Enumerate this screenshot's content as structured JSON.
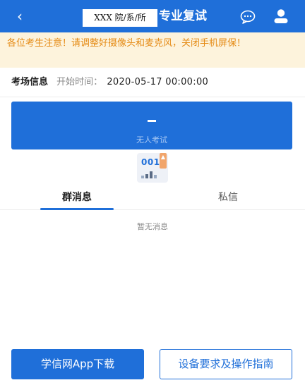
{
  "header": {
    "back_icon": "chevron-left-icon",
    "title_mask": "XXX 院/系/所",
    "title": "专业复试",
    "chat_icon": "chat-bubble-icon",
    "user_icon": "user-icon",
    "background": "#1f6fd9"
  },
  "notice": {
    "text": "各位考生注意！请调整好摄像头和麦克风，关闭手机屏保！",
    "color": "#e58b16",
    "background": "#fdf3dc"
  },
  "exam_info": {
    "label": "考场信息",
    "start_time_label": "开始时间：",
    "start_time": "2020-05-17 00:00:00"
  },
  "exam_panel": {
    "status": "无人考试"
  },
  "room": {
    "code": "001"
  },
  "tabs": [
    {
      "label": "群消息",
      "active": true
    },
    {
      "label": "私信",
      "active": false
    }
  ],
  "messages": {
    "empty_text": "暂无消息"
  },
  "footer": {
    "download_label": "学信网App下载",
    "guide_label": "设备要求及操作指南"
  }
}
